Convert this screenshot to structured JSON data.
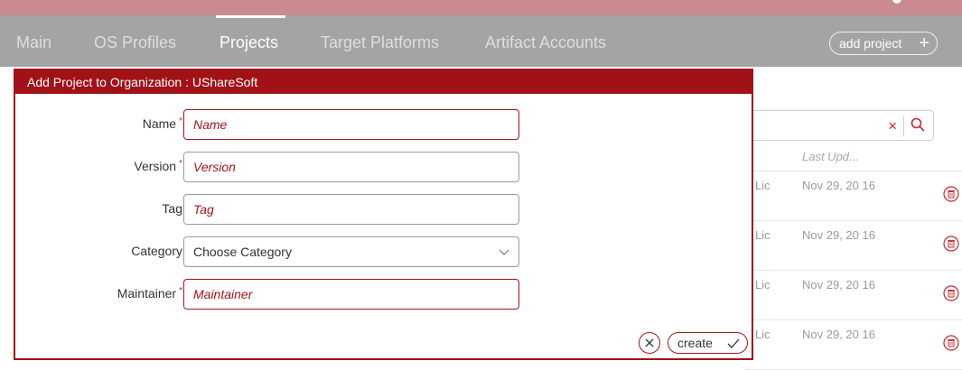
{
  "nav": {
    "items": [
      {
        "label": "Main"
      },
      {
        "label": "OS Profiles"
      },
      {
        "label": "Projects"
      },
      {
        "label": "Target Platforms"
      },
      {
        "label": "Artifact Accounts"
      }
    ],
    "active": "Projects",
    "add_project_label": "add project",
    "add_project_icon": "plus-icon"
  },
  "background_list": {
    "column_header": "Last Upd...",
    "rows": [
      {
        "license": "Lic",
        "date": "Nov 29, 20 16"
      },
      {
        "license": "Lic",
        "date": "Nov 29, 20 16"
      },
      {
        "license": "Lic",
        "date": "Nov 29, 20 16"
      },
      {
        "license": "Lic",
        "date": "Nov 29, 20 16"
      }
    ]
  },
  "modal": {
    "title": "Add Project to Organization : UShareSoft",
    "fields": {
      "name": {
        "label": "Name",
        "required": true,
        "placeholder": "Name",
        "value": ""
      },
      "version": {
        "label": "Version",
        "required": true,
        "placeholder": "Version",
        "value": ""
      },
      "tag": {
        "label": "Tag",
        "required": false,
        "placeholder": "Tag",
        "value": ""
      },
      "category": {
        "label": "Category",
        "selected": "Choose Category"
      },
      "maintainer": {
        "label": "Maintainer",
        "required": true,
        "placeholder": "Maintainer",
        "value": ""
      }
    },
    "required_mark": "*",
    "create_label": "create"
  },
  "colors": {
    "accent": "#a01218",
    "nav_bg": "#a5a3a3",
    "top_strip": "#c98b90"
  }
}
